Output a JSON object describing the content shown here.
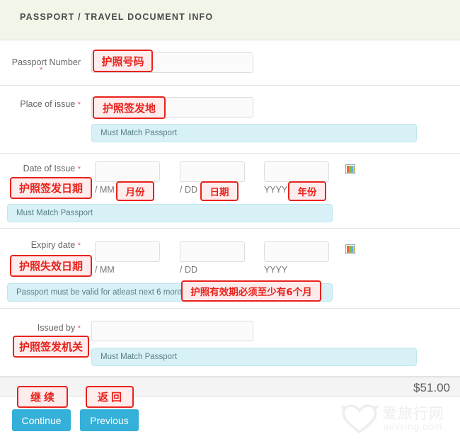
{
  "header": {
    "title": "PASSPORT / TRAVEL DOCUMENT INFO"
  },
  "fields": {
    "passport_number": {
      "label": "Passport Number",
      "required_mark": "*",
      "value": "",
      "annotation": "护照号码"
    },
    "place_of_issue": {
      "label": "Place of issue",
      "required_mark": "*",
      "value": "",
      "hint": "Must Match Passport",
      "annotation": "护照签发地"
    },
    "date_of_issue": {
      "label": "Date of Issue",
      "required_mark": "*",
      "mm_value": "",
      "dd_value": "",
      "yyyy_value": "",
      "mm_sep": "/ MM",
      "dd_sep": "/ DD",
      "yyyy_sep": "YYYY",
      "hint": "Must Match Passport",
      "annotation": "护照签发日期",
      "annotation_mm": "月份",
      "annotation_dd": "日期",
      "annotation_yyyy": "年份",
      "picker_icon": "calendar-picker-icon"
    },
    "expiry_date": {
      "label": "Expiry date",
      "required_mark": "*",
      "mm_value": "",
      "dd_value": "",
      "yyyy_value": "",
      "mm_sep": "/ MM",
      "dd_sep": "/ DD",
      "yyyy_sep": "YYYY",
      "hint": "Passport must be valid for atleast next 6 months",
      "annotation": "护照失效日期",
      "annotation_hint": "护照有效期必须至少有6个月",
      "picker_icon": "calendar-picker-icon"
    },
    "issued_by": {
      "label": "Issued by",
      "required_mark": "*",
      "value": "",
      "hint": "Must Match Passport",
      "annotation": "护照签发机关"
    }
  },
  "footer": {
    "price": "$51.00",
    "continue_label": "Continue",
    "previous_label": "Previous",
    "continue_annotation": "继续",
    "previous_annotation": "返回"
  },
  "watermark": {
    "brand": "爱旅行网",
    "domain": "ailvxing.com"
  },
  "colors": {
    "header_bg": "#f2f6e9",
    "hint_bg": "#d8f1f7",
    "hint_text": "#5a7f88",
    "button": "#35b0d8",
    "annotation": "#e8221c",
    "required": "#e05a5a"
  }
}
